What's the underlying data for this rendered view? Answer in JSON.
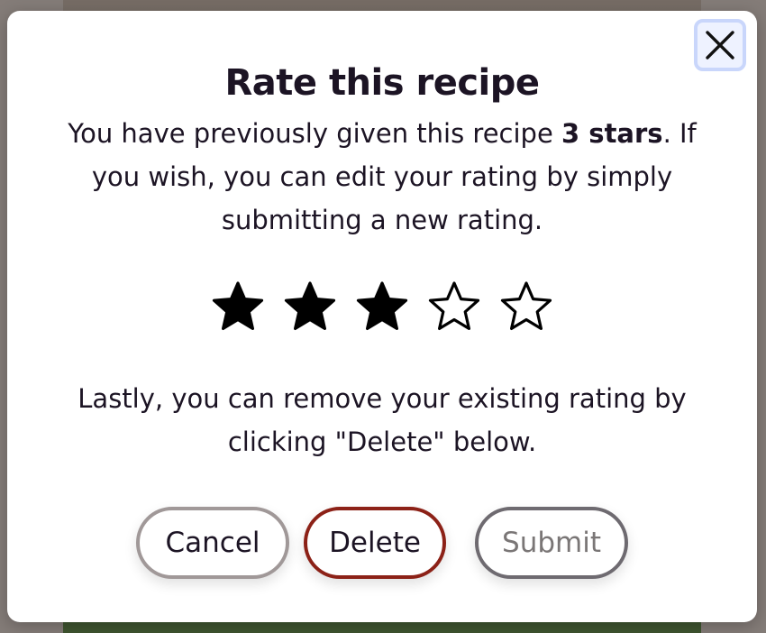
{
  "modal": {
    "title": "Rate this recipe",
    "intro_part1": "You have previously given this recipe ",
    "intro_bold": "3 stars",
    "intro_part2": ". If you wish, you can edit your rating by simply submitting a new rating.",
    "delete_note": "Lastly, you can remove your existing rating by clicking \"Delete\" below.",
    "rating": {
      "value": 3,
      "max": 5
    },
    "buttons": {
      "cancel": "Cancel",
      "delete": "Delete",
      "submit": "Submit"
    }
  },
  "icons": {
    "close": "close-icon",
    "star_filled": "star-filled-icon",
    "star_outline": "star-outline-icon"
  },
  "colors": {
    "text": "#1c1424",
    "delete_border": "#8c2117",
    "close_focus_ring": "#c9d6fb"
  }
}
